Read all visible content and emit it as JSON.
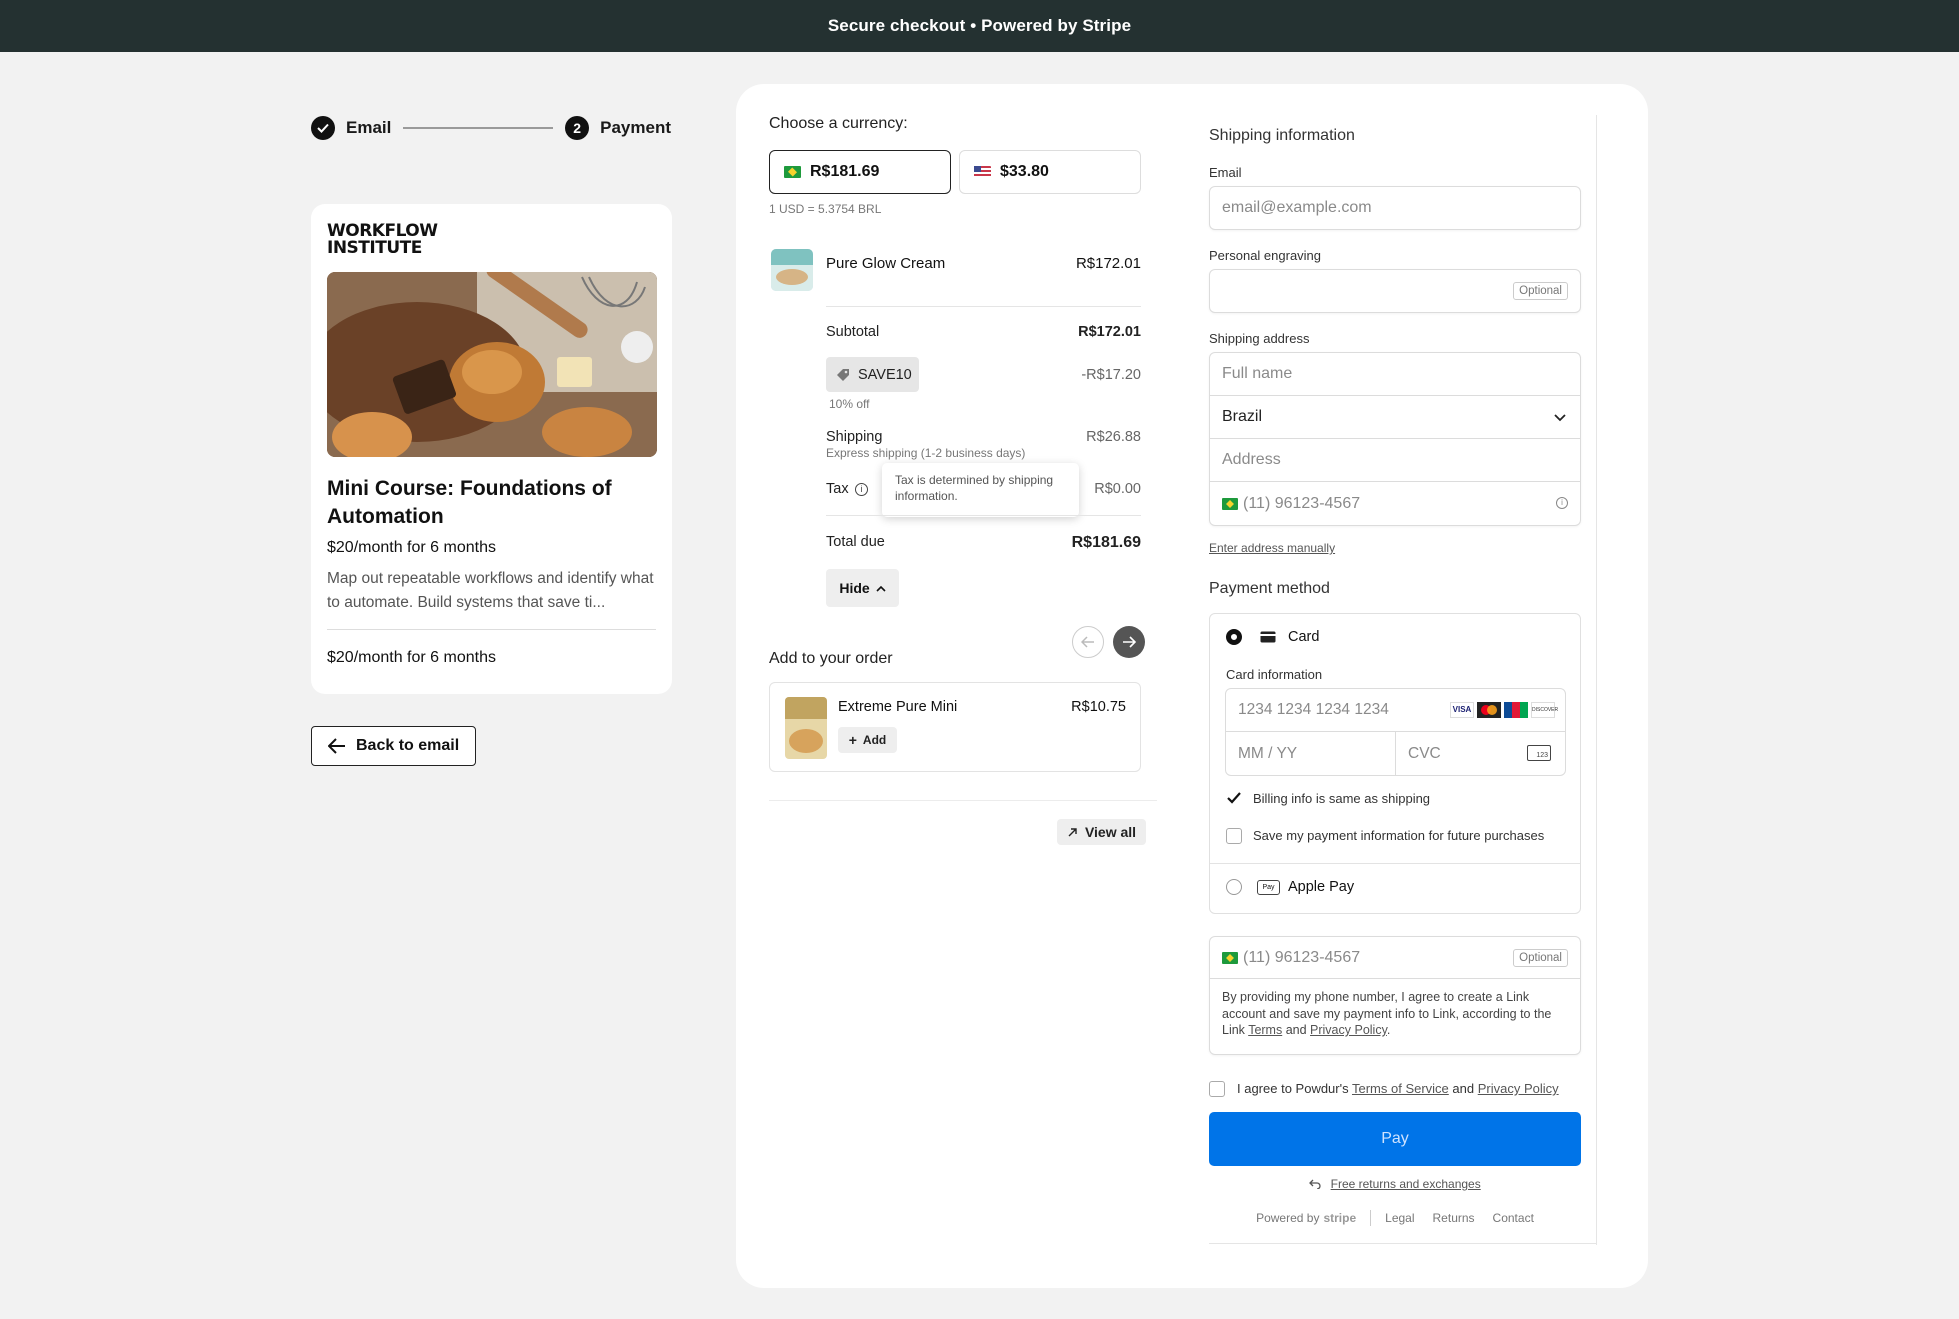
{
  "topbar": {
    "title": "Secure checkout • Powered by Stripe"
  },
  "steps": {
    "step1_label": "Email",
    "step2_number": "2",
    "step2_label": "Payment"
  },
  "product": {
    "logo_line1": "WORKFLOW",
    "logo_line2": "INSTITUTE",
    "title": "Mini Course: Foundations of Automation",
    "price": "$20/month for 6 months",
    "description": "Map out repeatable workflows and identify what to automate. Build systems that save ti...",
    "price_footer": "$20/month for 6 months"
  },
  "back_button": {
    "label": "Back to email"
  },
  "summary": {
    "currency_label": "Choose a currency:",
    "currency_brl": "R$181.69",
    "currency_usd": "$33.80",
    "rate": "1 USD = 5.3754 BRL",
    "item_name": "Pure Glow Cream",
    "item_price": "R$172.01",
    "subtotal_label": "Subtotal",
    "subtotal_value": "R$172.01",
    "promo_code": "SAVE10",
    "promo_value": "-R$17.20",
    "promo_note": "10% off",
    "shipping_label": "Shipping",
    "shipping_note": "Express shipping (1-2 business days)",
    "shipping_value": "R$26.88",
    "tax_label": "Tax",
    "tax_value": "R$0.00",
    "tax_tooltip": "Tax is determined by shipping information.",
    "total_label": "Total due",
    "total_value": "R$181.69",
    "hide_label": "Hide",
    "add_heading": "Add to your order",
    "upsell_name": "Extreme Pure Mini",
    "upsell_price": "R$10.75",
    "upsell_add": "Add",
    "view_all": "View all"
  },
  "shipping": {
    "title": "Shipping information",
    "email_label": "Email",
    "email_placeholder": "email@example.com",
    "engraving_label": "Personal engraving",
    "optional": "Optional",
    "address_label": "Shipping address",
    "fullname_placeholder": "Full name",
    "country": "Brazil",
    "address_placeholder": "Address",
    "phone_placeholder": "(11) 96123-4567",
    "manual_link": "Enter address manually"
  },
  "payment": {
    "title": "Payment method",
    "card_label": "Card",
    "card_info_label": "Card information",
    "card_number_placeholder": "1234 1234 1234 1234",
    "expiry_placeholder": "MM / YY",
    "cvc_placeholder": "CVC",
    "billing_same": "Billing info is same as shipping",
    "save_info": "Save my payment information for future purchases",
    "apple_pay": "Apple Pay",
    "brand_visa": "VISA",
    "brand_discover": "DISCOVER",
    "apple_pay_badge": "Pay",
    "cvc_badge": "123"
  },
  "link": {
    "phone_placeholder": "(11) 96123-4567",
    "optional": "Optional",
    "consent_1": "By providing my phone number, I agree to create a Link account and save my payment info to Link, according to the Link ",
    "terms": "Terms",
    "and": " and ",
    "privacy": "Privacy Policy",
    "end": "."
  },
  "agree": {
    "text_1": "I agree to Powdur's ",
    "tos": "Terms of Service",
    "and": " and ",
    "privacy": "Privacy Policy"
  },
  "pay_button": "Pay",
  "returns_link": "Free returns and exchanges",
  "footer": {
    "powered_by": "Powered by",
    "stripe": "stripe",
    "legal": "Legal",
    "returns": "Returns",
    "contact": "Contact"
  },
  "colors": {
    "topbar": "#243131",
    "pay_button": "#0074e8",
    "accent_dark": "#111111"
  }
}
